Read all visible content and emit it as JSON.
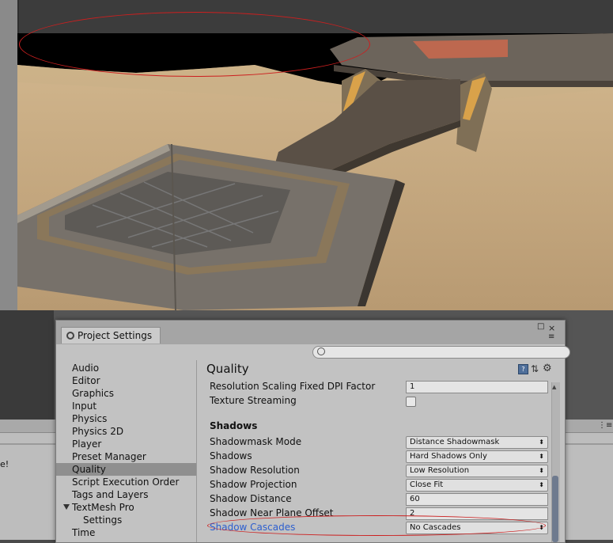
{
  "window": {
    "tab_title": "Project Settings",
    "search_placeholder": "",
    "close_glyph": "×",
    "max_glyph": "□",
    "menu_glyph": "≡"
  },
  "nav": {
    "items": [
      {
        "label": "Audio"
      },
      {
        "label": "Editor"
      },
      {
        "label": "Graphics"
      },
      {
        "label": "Input"
      },
      {
        "label": "Physics"
      },
      {
        "label": "Physics 2D"
      },
      {
        "label": "Player"
      },
      {
        "label": "Preset Manager"
      },
      {
        "label": "Quality",
        "selected": true
      },
      {
        "label": "Script Execution Order"
      },
      {
        "label": "Tags and Layers"
      },
      {
        "label": "TextMesh Pro",
        "foldout": true
      },
      {
        "label": "Settings",
        "sub": true
      },
      {
        "label": "Time"
      }
    ]
  },
  "quality": {
    "title": "Quality",
    "help_glyph": "?",
    "preset_glyph": "⇅",
    "settings_glyph": "⚙",
    "rows": {
      "res_scaling": {
        "label": "Resolution Scaling Fixed DPI Factor",
        "value": "1"
      },
      "texture_streaming": {
        "label": "Texture Streaming",
        "checked": false
      },
      "shadows_header": "Shadows",
      "shadowmask_mode": {
        "label": "Shadowmask Mode",
        "value": "Distance Shadowmask"
      },
      "shadows": {
        "label": "Shadows",
        "value": "Hard Shadows Only"
      },
      "shadow_resolution": {
        "label": "Shadow Resolution",
        "value": "Low Resolution"
      },
      "shadow_projection": {
        "label": "Shadow Projection",
        "value": "Close Fit"
      },
      "shadow_distance": {
        "label": "Shadow Distance",
        "value": "60"
      },
      "shadow_near_plane": {
        "label": "Shadow Near Plane Offset",
        "value": "2"
      },
      "shadow_cascades": {
        "label": "Shadow Cascades",
        "value": "No Cascades"
      }
    },
    "dropdown_arrow": "⬍"
  },
  "background": {
    "console_text": "e!",
    "right_menu_dots": "⋮≡"
  },
  "colors": {
    "annotation": "#cc1f1f",
    "link_label": "#2d5fcf",
    "selected_nav": "#8f8f8f"
  }
}
